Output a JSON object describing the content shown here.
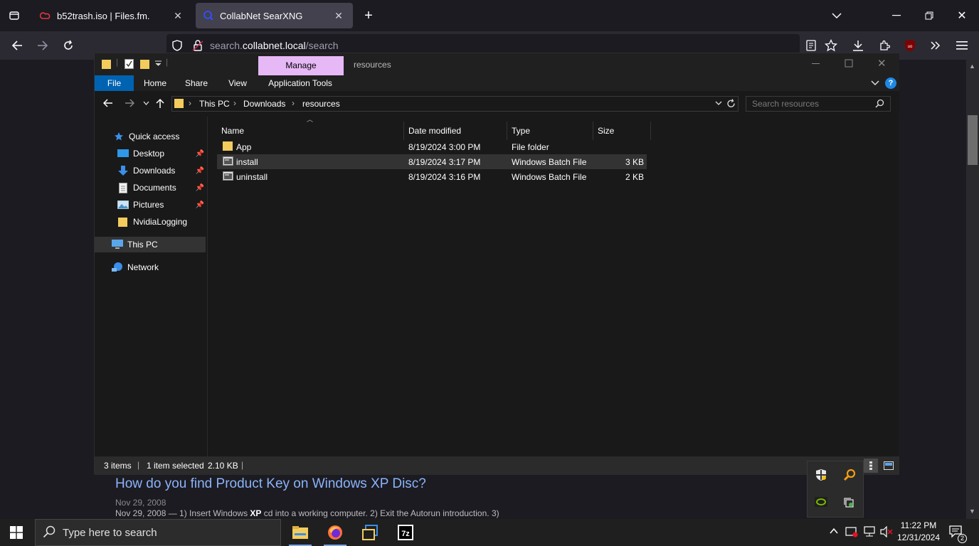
{
  "browser": {
    "tabs": [
      {
        "label": "b52trash.iso | Files.fm.",
        "active": false
      },
      {
        "label": "CollabNet SearXNG",
        "active": true
      }
    ],
    "url": {
      "prefix": "search.",
      "domain": "collabnet.local",
      "path": "/search"
    },
    "new_tab": "+"
  },
  "page": {
    "result_title": "How do you find Product Key on Windows XP Disc?",
    "result_date": "Nov 29, 2008",
    "result_snippet_start": "Nov 29, 2008 — 1) Insert Windows ",
    "result_snippet_bold": "XP",
    "result_snippet_end": " cd into a working computer. 2) Exit the Autorun introduction. 3)"
  },
  "explorer": {
    "manage_tab": "Manage",
    "window_title": "resources",
    "ribbon_tabs": [
      "File",
      "Home",
      "Share",
      "View",
      "Application Tools"
    ],
    "breadcrumb": [
      "This PC",
      "Downloads",
      "resources"
    ],
    "search_placeholder": "Search resources",
    "nav": {
      "quick_access": "Quick access",
      "items": [
        {
          "label": "Desktop",
          "pinned": true
        },
        {
          "label": "Downloads",
          "pinned": true
        },
        {
          "label": "Documents",
          "pinned": true
        },
        {
          "label": "Pictures",
          "pinned": true
        },
        {
          "label": "NvidiaLogging",
          "pinned": false
        }
      ],
      "this_pc": "This PC",
      "network": "Network"
    },
    "columns": [
      "Name",
      "Date modified",
      "Type",
      "Size"
    ],
    "files": [
      {
        "name": "App",
        "date": "8/19/2024 3:00 PM",
        "type": "File folder",
        "size": ""
      },
      {
        "name": "install",
        "date": "8/19/2024 3:17 PM",
        "type": "Windows Batch File",
        "size": "3 KB"
      },
      {
        "name": "uninstall",
        "date": "8/19/2024 3:16 PM",
        "type": "Windows Batch File",
        "size": "2 KB"
      }
    ],
    "status": {
      "items": "3 items",
      "selected": "1 item selected",
      "size": "2.10 KB"
    },
    "accent": "#0063b1"
  },
  "taskbar": {
    "search_placeholder": "Type here to search",
    "time": "11:22 PM",
    "date": "12/31/2024",
    "notification_count": "2"
  }
}
